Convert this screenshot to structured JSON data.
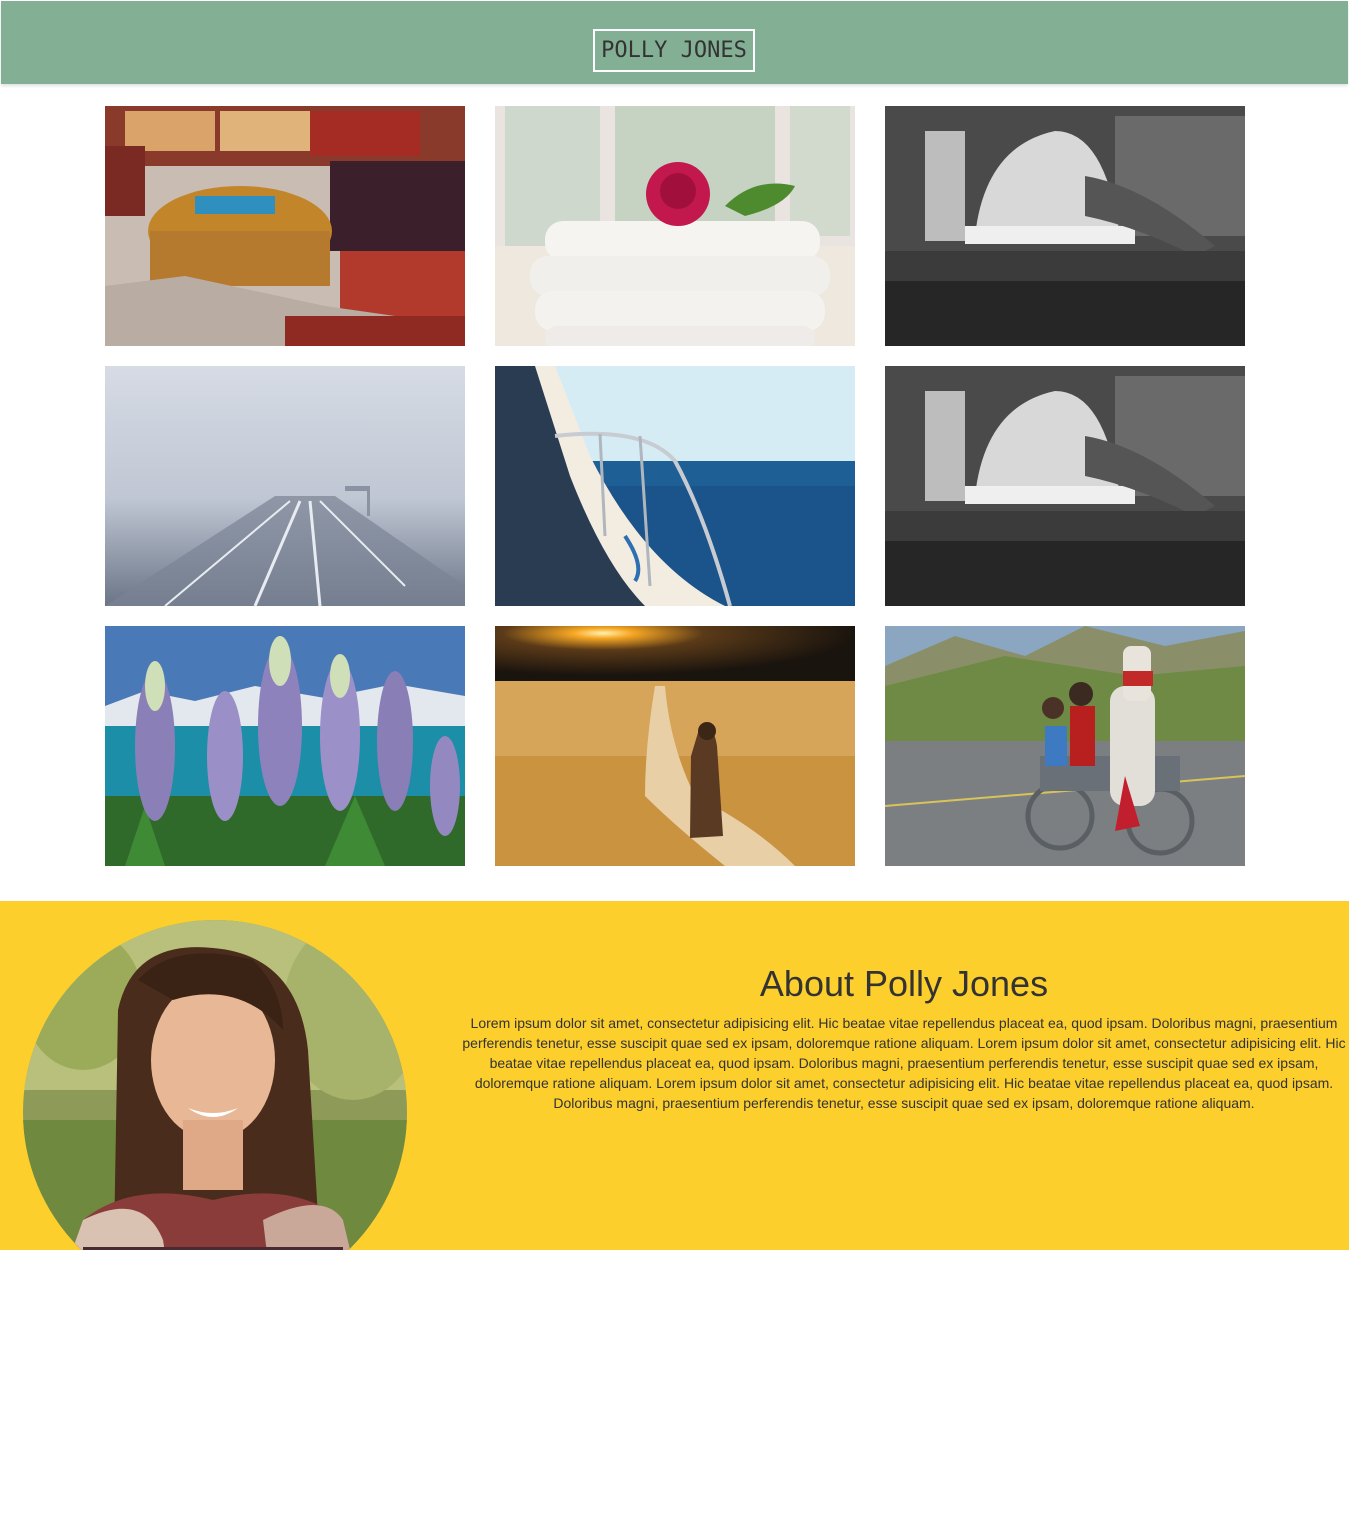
{
  "header": {
    "logo_text": "POLLY JONES",
    "background_color": "#83b094"
  },
  "gallery": {
    "photos": [
      {
        "name": "cushions-photo"
      },
      {
        "name": "rose-towels-photo"
      },
      {
        "name": "car-mechanic-photo"
      },
      {
        "name": "foggy-highway-photo"
      },
      {
        "name": "boat-sea-photo"
      },
      {
        "name": "car-mechanic-photo-2"
      },
      {
        "name": "lupine-flowers-photo"
      },
      {
        "name": "monk-field-photo"
      },
      {
        "name": "horse-cart-photo"
      }
    ]
  },
  "about": {
    "title": "About Polly Jones",
    "body": "Lorem ipsum dolor sit amet, consectetur adipisicing elit. Hic beatae vitae repellendus placeat ea, quod ipsam. Doloribus magni, praesentium perferendis tenetur, esse suscipit quae sed ex ipsam, doloremque ratione aliquam. Lorem ipsum dolor sit amet, consectetur adipisicing elit. Hic beatae vitae repellendus placeat ea, quod ipsam. Doloribus magni, praesentium perferendis tenetur, esse suscipit quae sed ex ipsam, doloremque ratione aliquam. Lorem ipsum dolor sit amet, consectetur adipisicing elit. Hic beatae vitae repellendus placeat ea, quod ipsam. Doloribus magni, praesentium perferendis tenetur, esse suscipit quae sed ex ipsam, doloremque ratione aliquam.",
    "background_color": "#fdcf2c"
  }
}
